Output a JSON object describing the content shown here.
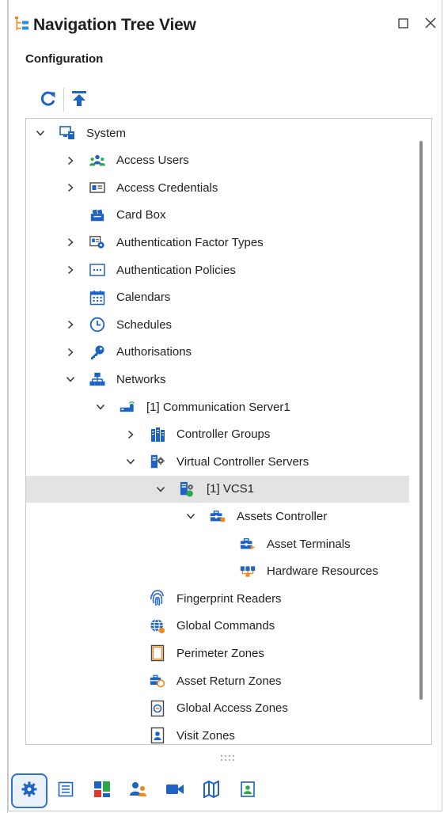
{
  "window": {
    "title": "Navigation Tree View",
    "icon": "tree-view-icon",
    "maximize_icon": "maximize-icon",
    "close_icon": "close-icon"
  },
  "section": {
    "label": "Configuration"
  },
  "toolbar": {
    "refresh_icon": "refresh-icon",
    "collapse_all_icon": "collapse-to-top-icon"
  },
  "tree": {
    "nodes": [
      {
        "label": "System",
        "icon": "system-computer-icon",
        "state": "expanded",
        "selected": false
      },
      {
        "label": "Access Users",
        "icon": "users-icon",
        "state": "collapsed",
        "selected": false
      },
      {
        "label": "Access Credentials",
        "icon": "id-card-icon",
        "state": "collapsed",
        "selected": false
      },
      {
        "label": "Card Box",
        "icon": "card-box-icon",
        "state": "none",
        "selected": false
      },
      {
        "label": "Authentication Factor Types",
        "icon": "auth-factor-icon",
        "state": "collapsed",
        "selected": false
      },
      {
        "label": "Authentication Policies",
        "icon": "policy-icon",
        "state": "collapsed",
        "selected": false
      },
      {
        "label": "Calendars",
        "icon": "calendar-icon",
        "state": "none",
        "selected": false
      },
      {
        "label": "Schedules",
        "icon": "clock-icon",
        "state": "collapsed",
        "selected": false
      },
      {
        "label": "Authorisations",
        "icon": "key-icon",
        "state": "collapsed",
        "selected": false
      },
      {
        "label": "Networks",
        "icon": "network-icon",
        "state": "expanded",
        "selected": false
      },
      {
        "label": "[1] Communication Server1",
        "icon": "communication-server-icon",
        "state": "expanded",
        "selected": false
      },
      {
        "label": "Controller Groups",
        "icon": "controller-groups-icon",
        "state": "collapsed",
        "selected": false
      },
      {
        "label": "Virtual Controller Servers",
        "icon": "virtual-server-icon",
        "state": "expanded",
        "selected": false
      },
      {
        "label": "[1] VCS1",
        "icon": "vcs-server-icon",
        "state": "expanded",
        "selected": true
      },
      {
        "label": "Assets Controller",
        "icon": "assets-controller-icon",
        "state": "expanded",
        "selected": false
      },
      {
        "label": "Asset Terminals",
        "icon": "asset-terminal-icon",
        "state": "none",
        "selected": false
      },
      {
        "label": "Hardware Resources",
        "icon": "hardware-resources-icon",
        "state": "none",
        "selected": false
      },
      {
        "label": "Fingerprint Readers",
        "icon": "fingerprint-icon",
        "state": "none",
        "selected": false
      },
      {
        "label": "Global Commands",
        "icon": "global-commands-icon",
        "state": "none",
        "selected": false
      },
      {
        "label": "Perimeter Zones",
        "icon": "perimeter-zone-icon",
        "state": "none",
        "selected": false
      },
      {
        "label": "Asset Return Zones",
        "icon": "asset-return-zone-icon",
        "state": "none",
        "selected": false
      },
      {
        "label": "Global Access Zones",
        "icon": "global-access-zone-icon",
        "state": "none",
        "selected": false
      },
      {
        "label": "Visit Zones",
        "icon": "visit-zone-icon",
        "state": "none",
        "selected": false
      }
    ]
  },
  "bottom_tabs": [
    {
      "icon": "gear-icon",
      "active": true
    },
    {
      "icon": "list-icon",
      "active": false
    },
    {
      "icon": "dashboard-icon",
      "active": false
    },
    {
      "icon": "user-group-icon",
      "active": false
    },
    {
      "icon": "video-camera-icon",
      "active": false
    },
    {
      "icon": "map-icon",
      "active": false
    },
    {
      "icon": "contact-card-icon",
      "active": false
    }
  ],
  "colors": {
    "accent": "#2f6fd6",
    "icon_blue": "#1e63c4",
    "icon_orange": "#f08a1c",
    "selection": "#e3e3e3"
  }
}
